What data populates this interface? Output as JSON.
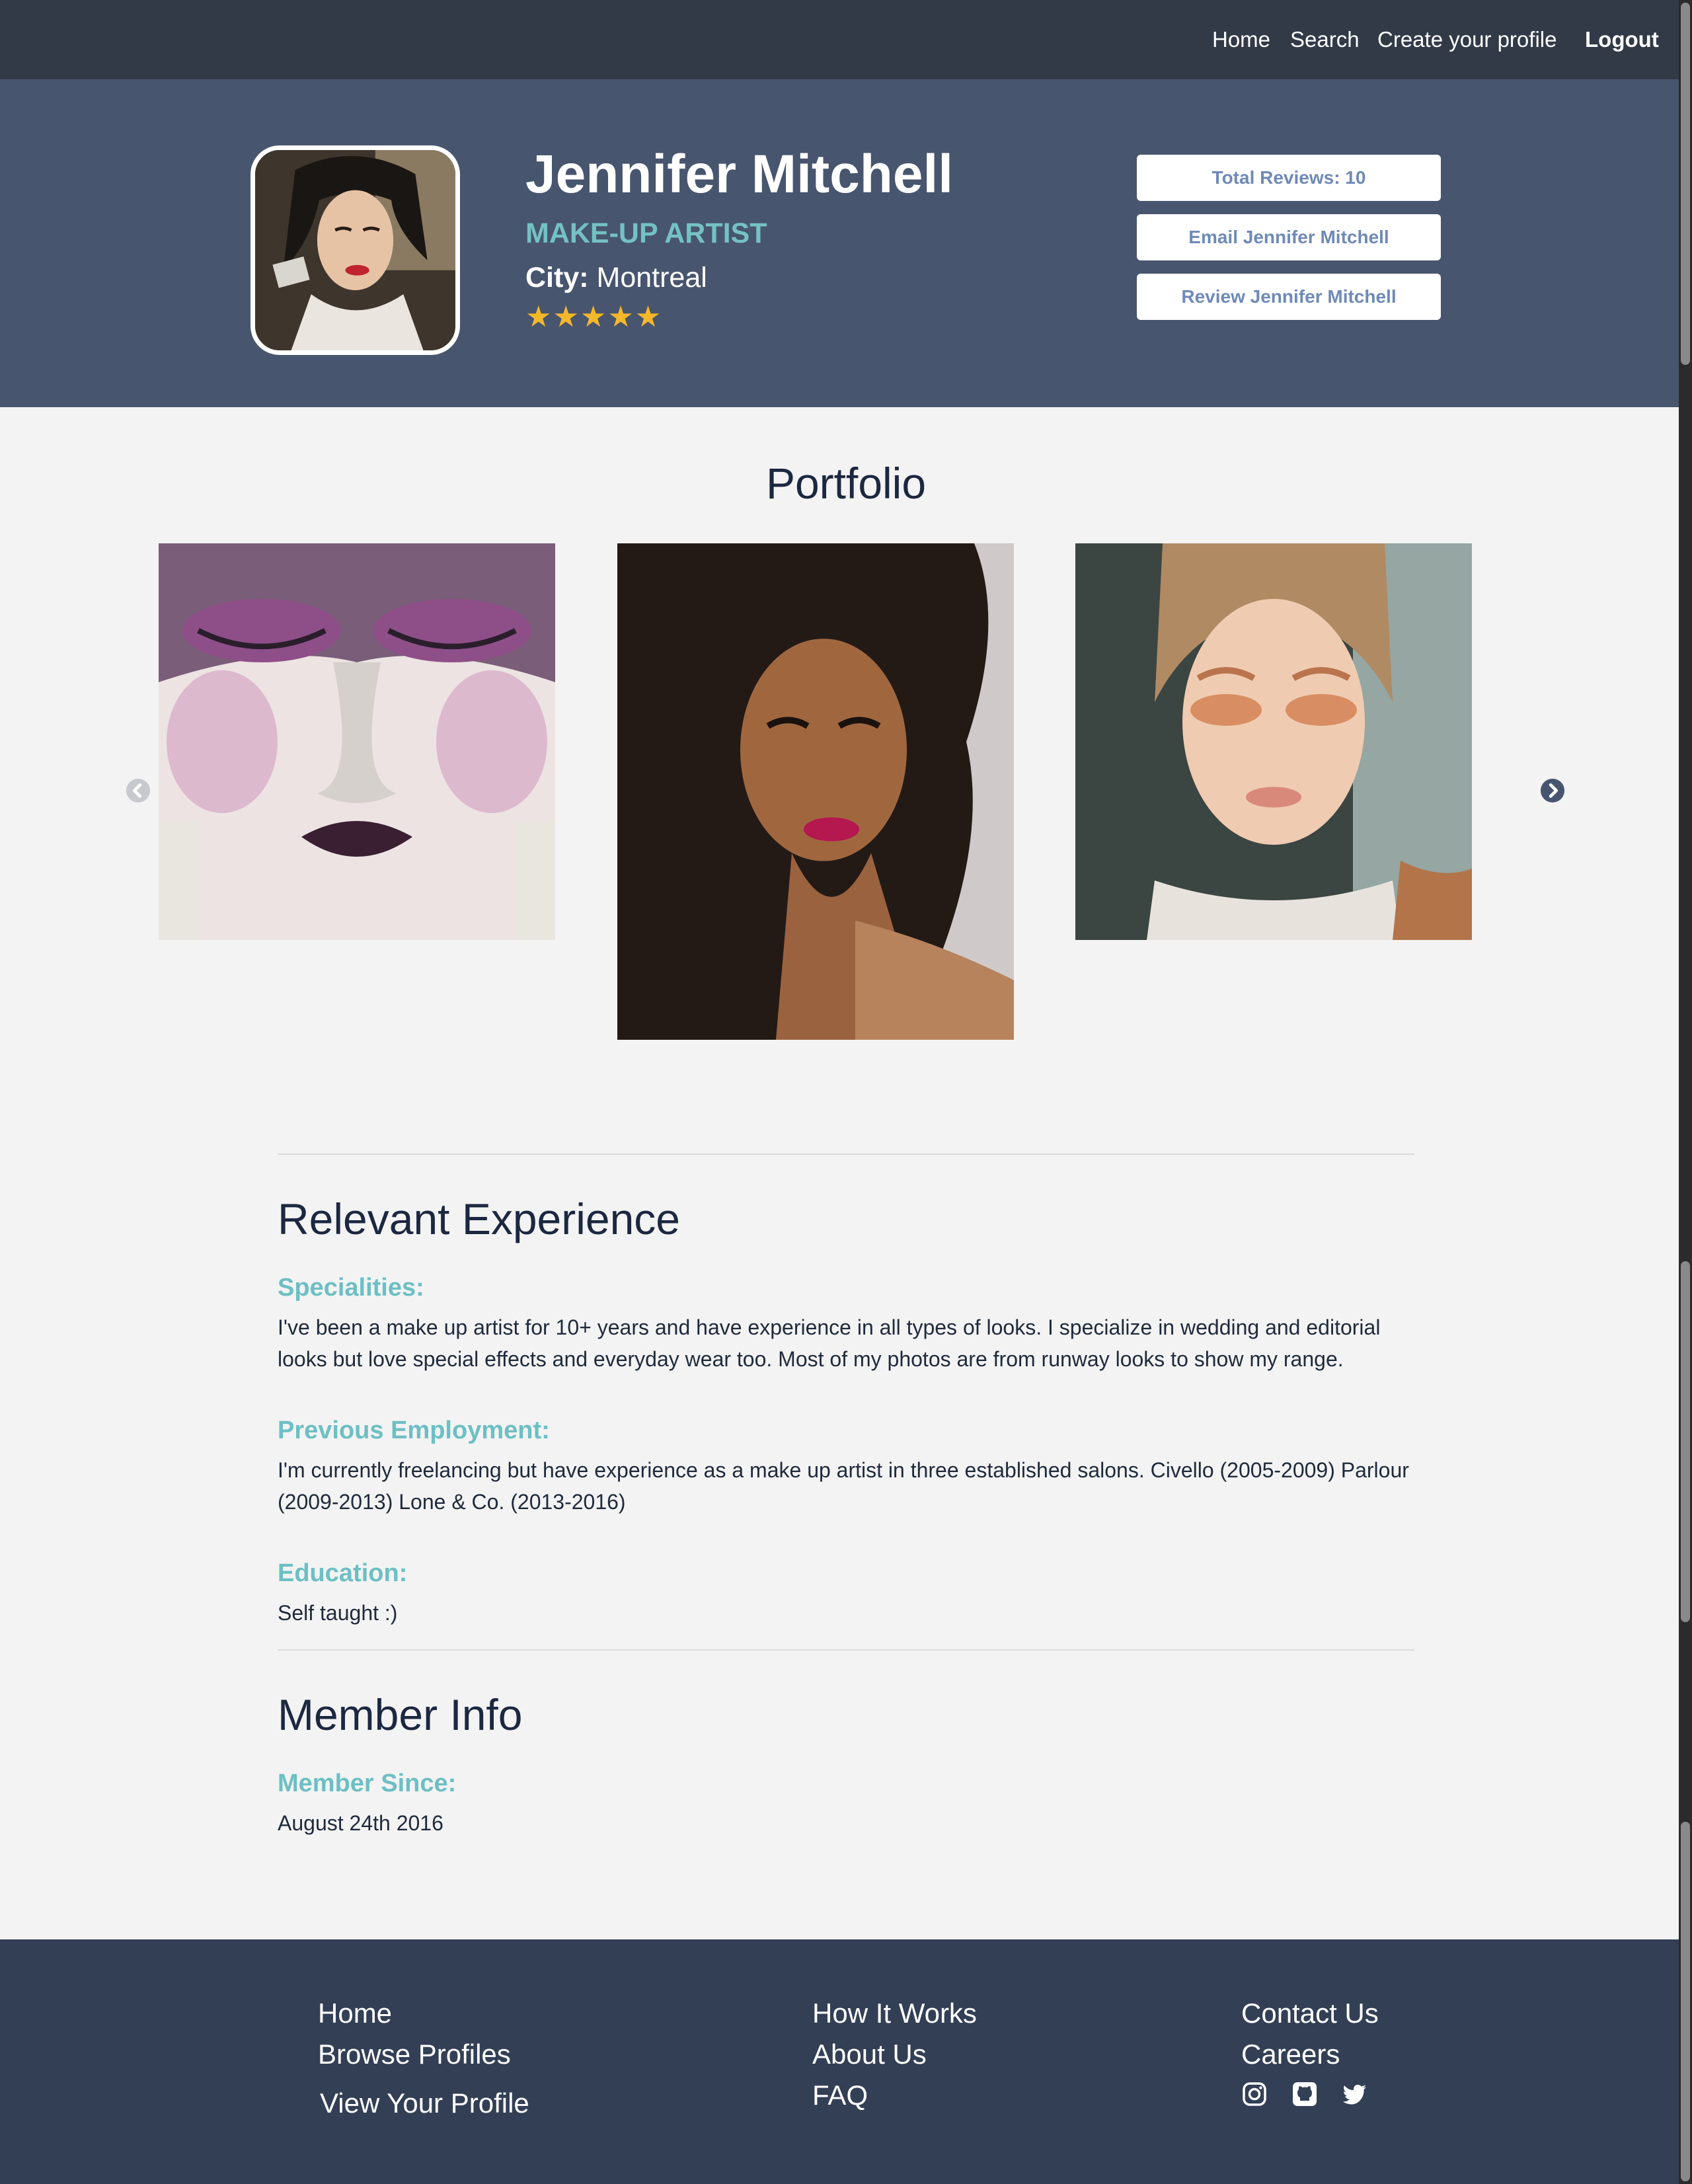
{
  "nav": {
    "links": [
      "Home",
      "Search",
      "Create your profile"
    ],
    "logout": "Logout"
  },
  "profile": {
    "name": "Jennifer Mitchell",
    "profession": "MAKE-UP ARTIST",
    "city_label": "City:",
    "city": "Montreal",
    "rating_stars": "★★★★★",
    "rating": 5,
    "buttons": {
      "reviews": "Total Reviews: 10",
      "email": "Email Jennifer Mitchell",
      "review": "Review Jennifer Mitchell"
    }
  },
  "portfolio": {
    "title": "Portfolio"
  },
  "experience": {
    "title": "Relevant Experience",
    "specialities_label": "Specialities:",
    "specialities": "I've been a make up artist for 10+ years and have experience in all types of looks. I specialize in wedding and editorial looks but love special effects and everyday wear too. Most of my photos are from runway looks to show my range.",
    "employment_label": "Previous Employment:",
    "employment": "I'm currently freelancing but have experience as a make up artist in three established salons. Civello (2005-2009) Parlour (2009-2013) Lone & Co. (2013-2016)",
    "education_label": "Education:",
    "education": "Self taught :)"
  },
  "member": {
    "title": "Member Info",
    "since_label": "Member Since:",
    "since": "August 24th 2016"
  },
  "footer": {
    "col1": [
      "Home",
      "Browse Profiles",
      "View Your Profile"
    ],
    "col2": [
      "How It Works",
      "About Us",
      "FAQ"
    ],
    "col3": [
      "Contact Us",
      "Careers"
    ],
    "social_icons": [
      "instagram-icon",
      "github-icon",
      "twitter-icon"
    ]
  },
  "colors": {
    "nav_bg": "#323a48",
    "hero_bg": "#48556e",
    "accent_teal": "#6dbfc3",
    "star_gold": "#f5b82a",
    "button_text": "#6f8ab7",
    "footer_bg": "#333f55"
  }
}
